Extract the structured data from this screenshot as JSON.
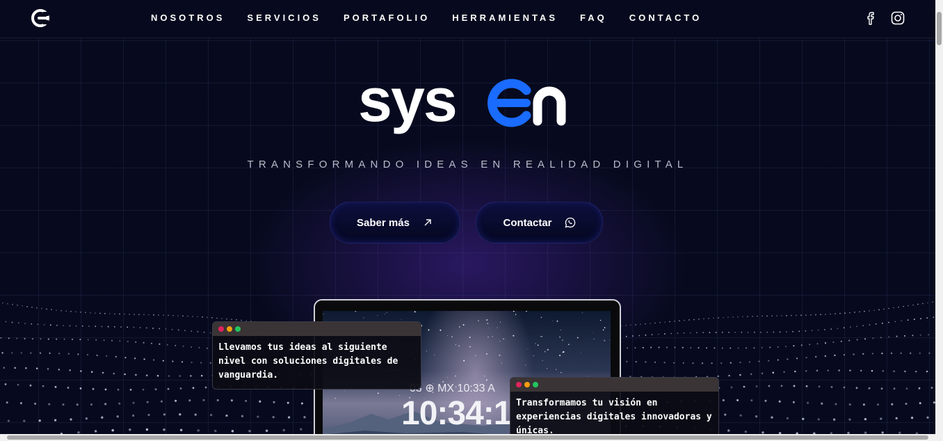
{
  "nav": {
    "logo_icon": "syson-logo-icon",
    "items": [
      "NOSOTROS",
      "SERVICIOS",
      "PORTAFOLIO",
      "HERRAMIENTAS",
      "FAQ",
      "CONTACTO"
    ],
    "social": [
      "facebook-icon",
      "instagram-icon"
    ]
  },
  "hero": {
    "brand": "sysen",
    "tagline": "TRANSFORMANDO IDEAS EN REALIDAD DIGITAL",
    "buttons": [
      {
        "label": "Saber más",
        "icon": "arrow-up-right-icon"
      },
      {
        "label": "Contactar",
        "icon": "whatsapp-icon"
      }
    ]
  },
  "laptop": {
    "date_line": "03 ⊕ MX 10:33 A",
    "time": "10:34:1"
  },
  "terminals": [
    {
      "text": "Llevamos tus ideas al siguiente nivel con soluciones digitales de vanguardia."
    },
    {
      "text": "Transformamos tu visión en experiencias digitales innovadoras y únicas."
    }
  ],
  "colors": {
    "background": "#070a1e",
    "accent": "#1a6bff",
    "glow": "#3a1f7a"
  }
}
